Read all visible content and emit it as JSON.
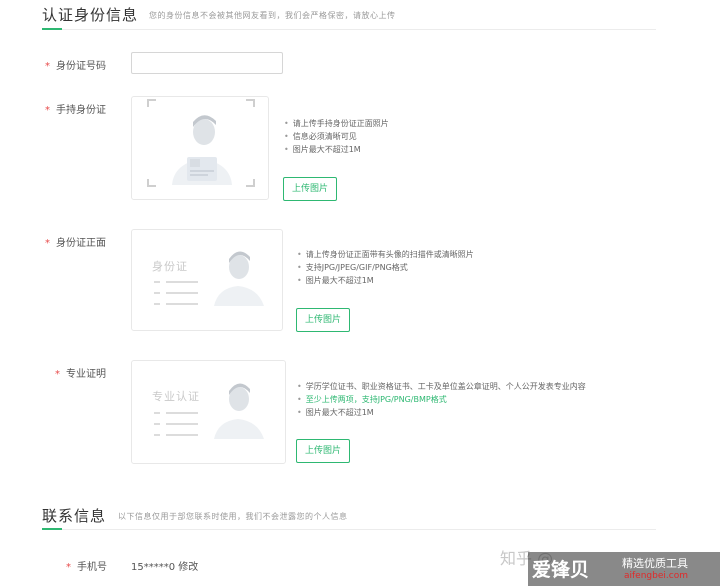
{
  "identity_section": {
    "title": "认证身份信息",
    "description": "您的身份信息不会被其他网友看到，我们会严格保密，请放心上传"
  },
  "id_number": {
    "label": "身份证号码",
    "value": "",
    "placeholder": ""
  },
  "handheld_id": {
    "label": "手持身份证",
    "hints": [
      "请上传手持身份证正面照片",
      "信息必须清晰可见",
      "图片最大不超过1M"
    ],
    "upload_label": "上传图片"
  },
  "id_front": {
    "label": "身份证正面",
    "card_text": "身份证",
    "hints": [
      "请上传身份证正面带有头像的扫描件或清晰照片",
      "支持JPG/JPEG/GIF/PNG格式",
      "图片最大不超过1M"
    ],
    "upload_label": "上传图片"
  },
  "professional_cert": {
    "label": "专业证明",
    "card_text": "专业认证",
    "hints": [
      "学历学位证书、职业资格证书、工卡及单位盖公章证明、个人公开发表专业内容",
      "至少上传两项，支持JPG/PNG/BMP格式",
      "图片最大不超过1M"
    ],
    "upload_label": "上传图片"
  },
  "contact_section": {
    "title": "联系信息",
    "description": "以下信息仅用于部您联系时使用，我们不会泄露您的个人信息"
  },
  "phone": {
    "label": "手机号",
    "value": "15*****0",
    "edit_label": "修改"
  },
  "watermark": {
    "zhihu": "知乎 @...",
    "site_cn": "爱锋贝",
    "site_slogan": "精选优质工具",
    "site_url": "aifengbei.com"
  },
  "colors": {
    "accent": "#2eb872",
    "required": "#e84a4a",
    "watermark_red": "#e02a2a"
  }
}
